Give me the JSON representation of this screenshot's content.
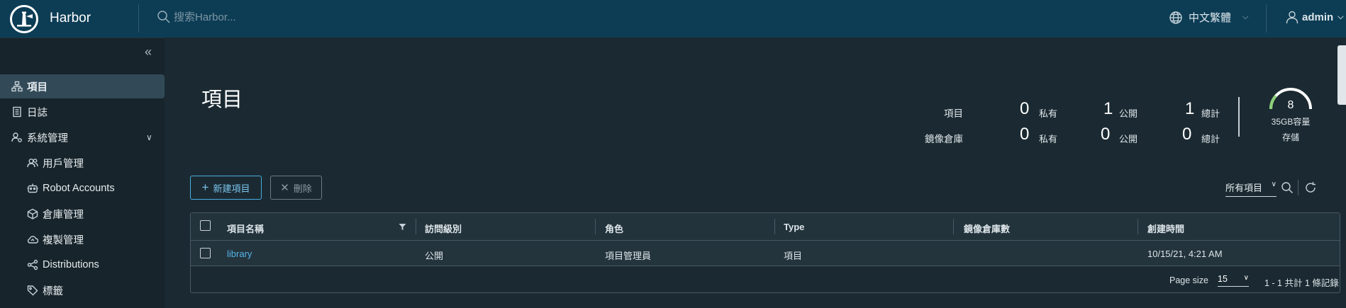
{
  "header": {
    "app_name": "Harbor",
    "search_placeholder": "搜索Harbor...",
    "language": "中文繁體",
    "user": "admin"
  },
  "sidebar": {
    "items": [
      {
        "label": "項目",
        "icon": "project-icon",
        "active": true
      },
      {
        "label": "日誌",
        "icon": "log-icon"
      },
      {
        "label": "系統管理",
        "icon": "admin-icon",
        "expanded": true
      },
      {
        "label": "用戶管理",
        "icon": "users-icon"
      },
      {
        "label": "Robot Accounts",
        "icon": "robot-icon"
      },
      {
        "label": "倉庫管理",
        "icon": "registry-icon"
      },
      {
        "label": "複製管理",
        "icon": "cloud-icon"
      },
      {
        "label": "Distributions",
        "icon": "share-icon"
      },
      {
        "label": "標籤",
        "icon": "tag-icon"
      }
    ]
  },
  "main": {
    "title": "項目",
    "stats": {
      "projects": {
        "label": "項目",
        "private": "0",
        "public": "1",
        "total": "1"
      },
      "repos": {
        "label": "鏡像倉庫",
        "private": "0",
        "public": "0",
        "total": "0"
      },
      "private_label": "私有",
      "public_label": "公開",
      "total_label": "總計"
    },
    "storage": {
      "value": "8",
      "capacity": "35GB容量",
      "label": "存儲",
      "used_fraction": 0.23,
      "accent": "#8bd07a"
    },
    "buttons": {
      "new_project": "新建項目",
      "delete": "刪除"
    },
    "filter": {
      "selected": "所有項目"
    },
    "table": {
      "columns": [
        "項目名稱",
        "訪問級別",
        "角色",
        "Type",
        "鏡像倉庫數",
        "創建時間"
      ],
      "rows": [
        {
          "name": "library",
          "access": "公開",
          "role": "項目管理員",
          "type": "項目",
          "repo_count": "",
          "created": "10/15/21, 4:21 AM"
        }
      ],
      "page_size_label": "Page size",
      "page_size": "15",
      "pagination_info": "1 - 1 共計 1 條記錄"
    }
  },
  "colors": {
    "header_bg": "#0d3d55",
    "accent": "#49aee0",
    "link": "#55b4ea"
  }
}
